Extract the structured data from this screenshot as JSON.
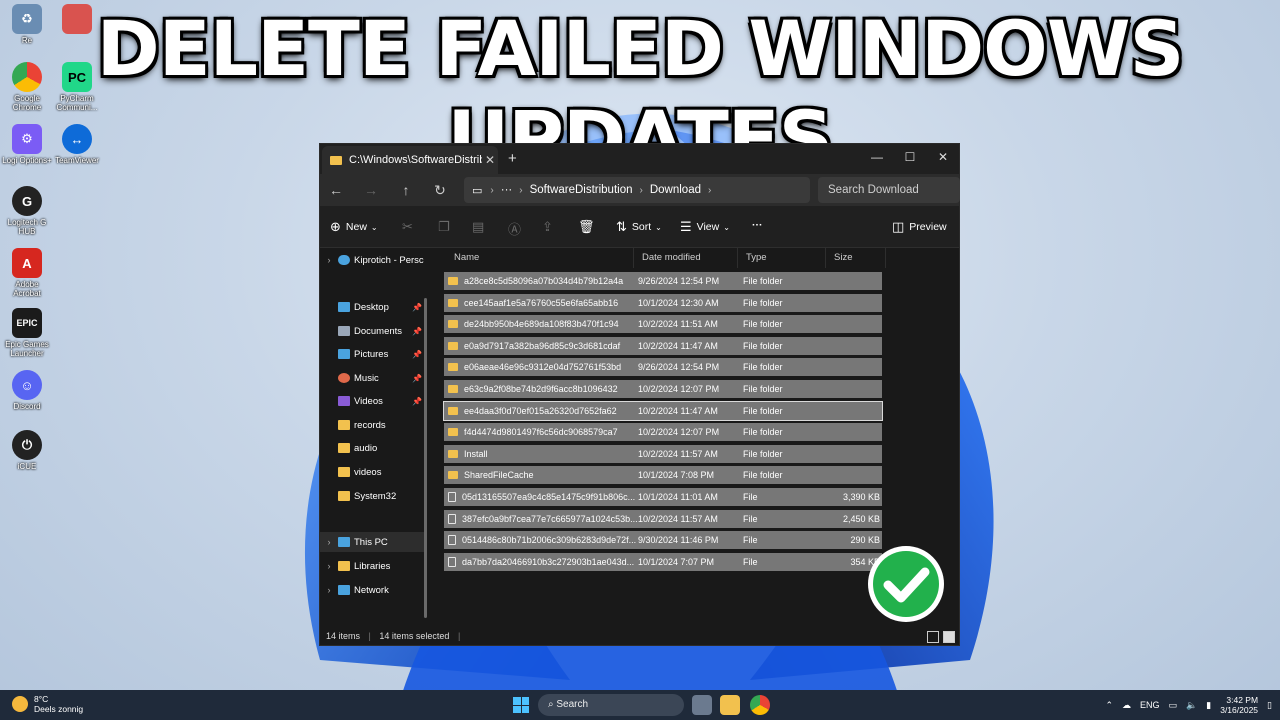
{
  "banner": {
    "title": "DELETE FAILED WINDOWS UPDATES"
  },
  "desktop_icons": [
    {
      "name": "Recycle Bin",
      "label": "Re",
      "icon": "recycle-bin-icon",
      "color": "#6a8db3"
    },
    {
      "name": "Unknown app",
      "label": "",
      "icon": "app-icon",
      "color": "#d9534f"
    },
    {
      "name": "Google Chrome",
      "label": "Google Chrome",
      "icon": "chrome-icon",
      "color": "#1a73e8"
    },
    {
      "name": "PyCharm",
      "label": "PyCharm Communi...",
      "icon": "pycharm-icon",
      "color": "#21d789"
    },
    {
      "name": "Logi Options+",
      "label": "Logi Options+",
      "icon": "logi-icon",
      "color": "#7b5cf5"
    },
    {
      "name": "TeamViewer",
      "label": "TeamViewer",
      "icon": "teamviewer-icon",
      "color": "#0e6bd8"
    },
    {
      "name": "Logitech G HUB",
      "label": "Logitech G HUB",
      "icon": "ghub-icon",
      "color": "#222222"
    },
    {
      "name": "Adobe Acrobat",
      "label": "Adobe Acrobat",
      "icon": "acrobat-icon",
      "color": "#d6271f"
    },
    {
      "name": "Epic Games Launcher",
      "label": "Epic Games Launcher",
      "icon": "epic-icon",
      "color": "#1b1b1b"
    },
    {
      "name": "Discord",
      "label": "Discord",
      "icon": "discord-icon",
      "color": "#5865f2"
    },
    {
      "name": "iCUE",
      "label": "iCUE",
      "icon": "icue-icon",
      "color": "#222222"
    }
  ],
  "window": {
    "tab_title": "C:\\Windows\\SoftwareDistrib",
    "breadcrumb": [
      "SoftwareDistribution",
      "Download"
    ],
    "search_placeholder": "Search Download",
    "commands": {
      "new": "New",
      "sort": "Sort",
      "view": "View",
      "more": "···",
      "preview": "Preview"
    },
    "nav": {
      "cloud": "Kiprotich - Persc",
      "quick": [
        {
          "label": "Desktop",
          "color": "#4aa3df",
          "pinned": true
        },
        {
          "label": "Documents",
          "color": "#9aa7b8",
          "pinned": true
        },
        {
          "label": "Pictures",
          "color": "#4aa3df",
          "pinned": true
        },
        {
          "label": "Music",
          "color": "#e0694a",
          "pinned": true
        },
        {
          "label": "Videos",
          "color": "#8a5cd6",
          "pinned": true
        },
        {
          "label": "records",
          "color": "#f2c14e",
          "pinned": false
        },
        {
          "label": "audio",
          "color": "#f2c14e",
          "pinned": false
        },
        {
          "label": "videos",
          "color": "#f2c14e",
          "pinned": false
        },
        {
          "label": "System32",
          "color": "#f2c14e",
          "pinned": false
        }
      ],
      "this_pc": "This PC",
      "libraries": "Libraries",
      "network": "Network"
    },
    "columns": {
      "name": "Name",
      "date": "Date modified",
      "type": "Type",
      "size": "Size"
    },
    "files": [
      {
        "name": "a28ce8c5d58096a07b034d4b79b12a4a",
        "date": "9/26/2024 12:54 PM",
        "type": "File folder",
        "size": "",
        "kind": "folder"
      },
      {
        "name": "cee145aaf1e5a76760c55e6fa65abb16",
        "date": "10/1/2024 12:30 AM",
        "type": "File folder",
        "size": "",
        "kind": "folder"
      },
      {
        "name": "de24bb950b4e689da108f83b470f1c94",
        "date": "10/2/2024 11:51 AM",
        "type": "File folder",
        "size": "",
        "kind": "folder"
      },
      {
        "name": "e0a9d7917a382ba96d85c9c3d681cdaf",
        "date": "10/2/2024 11:47 AM",
        "type": "File folder",
        "size": "",
        "kind": "folder"
      },
      {
        "name": "e06aeae46e96c9312e04d752761f53bd",
        "date": "9/26/2024 12:54 PM",
        "type": "File folder",
        "size": "",
        "kind": "folder"
      },
      {
        "name": "e63c9a2f08be74b2d9f6acc8b1096432",
        "date": "10/2/2024 12:07 PM",
        "type": "File folder",
        "size": "",
        "kind": "folder"
      },
      {
        "name": "ee4daa3f0d70ef015a26320d7652fa62",
        "date": "10/2/2024 11:47 AM",
        "type": "File folder",
        "size": "",
        "kind": "folder"
      },
      {
        "name": "f4d4474d9801497f6c56dc9068579ca7",
        "date": "10/2/2024 12:07 PM",
        "type": "File folder",
        "size": "",
        "kind": "folder"
      },
      {
        "name": "Install",
        "date": "10/2/2024 11:57 AM",
        "type": "File folder",
        "size": "",
        "kind": "folder"
      },
      {
        "name": "SharedFileCache",
        "date": "10/1/2024 7:08 PM",
        "type": "File folder",
        "size": "",
        "kind": "folder"
      },
      {
        "name": "05d13165507ea9c4c85e1475c9f91b806c...",
        "date": "10/1/2024 11:01 AM",
        "type": "File",
        "size": "3,390 KB",
        "kind": "file"
      },
      {
        "name": "387efc0a9bf7cea77e7c665977a1024c53b...",
        "date": "10/2/2024 11:57 AM",
        "type": "File",
        "size": "2,450 KB",
        "kind": "file"
      },
      {
        "name": "0514486c80b71b2006c309b6283d9de72f...",
        "date": "9/30/2024 11:46 PM",
        "type": "File",
        "size": "290 KB",
        "kind": "file"
      },
      {
        "name": "da7bb7da20466910b3c272903b1ae043d...",
        "date": "10/1/2024 7:07 PM",
        "type": "File",
        "size": "354 KB",
        "kind": "file"
      }
    ],
    "focused_row": 6,
    "status": {
      "items": "14 items",
      "selected": "14 items selected"
    }
  },
  "taskbar": {
    "weather_temp": "8°C",
    "weather_desc": "Deels zonnig",
    "search": "Search",
    "lang": "ENG",
    "time": "3:42 PM",
    "date": "3/16/2025"
  }
}
